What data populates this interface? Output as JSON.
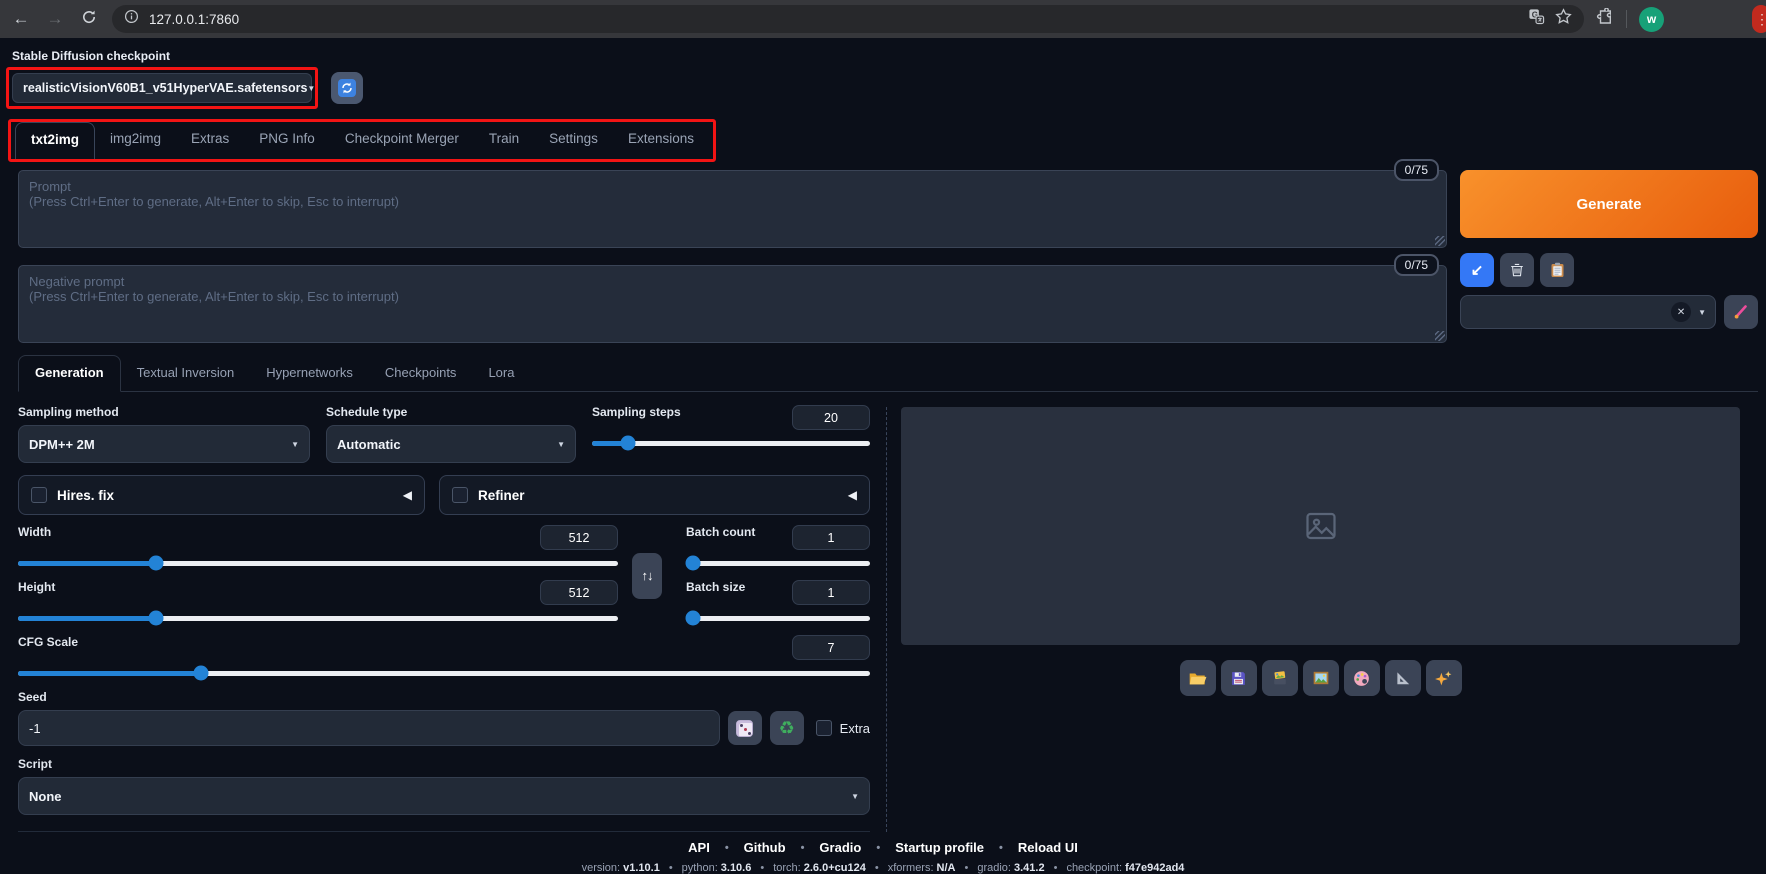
{
  "browser": {
    "url": "127.0.0.1:7860",
    "avatar_letter": "w"
  },
  "checkpoint": {
    "label": "Stable Diffusion checkpoint",
    "value": "realisticVisionV60B1_v51HyperVAE.safetensors"
  },
  "main_tabs": [
    "txt2img",
    "img2img",
    "Extras",
    "PNG Info",
    "Checkpoint Merger",
    "Train",
    "Settings",
    "Extensions"
  ],
  "active_main_tab": "txt2img",
  "prompt": {
    "counter": "0/75",
    "placeholder": "Prompt\n(Press Ctrl+Enter to generate, Alt+Enter to skip, Esc to interrupt)"
  },
  "negative_prompt": {
    "counter": "0/75",
    "placeholder": "Negative prompt\n(Press Ctrl+Enter to generate, Alt+Enter to skip, Esc to interrupt)"
  },
  "generate_label": "Generate",
  "sub_tabs": [
    "Generation",
    "Textual Inversion",
    "Hypernetworks",
    "Checkpoints",
    "Lora"
  ],
  "active_sub_tab": "Generation",
  "controls": {
    "sampling_method": {
      "label": "Sampling method",
      "value": "DPM++ 2M"
    },
    "schedule_type": {
      "label": "Schedule type",
      "value": "Automatic"
    },
    "sampling_steps": {
      "label": "Sampling steps",
      "value": "20",
      "fill_pct": 13
    },
    "hires_fix": {
      "label": "Hires. fix",
      "checked": false
    },
    "refiner": {
      "label": "Refiner",
      "checked": false
    },
    "width": {
      "label": "Width",
      "value": "512",
      "fill_pct": 23
    },
    "height": {
      "label": "Height",
      "value": "512",
      "fill_pct": 23
    },
    "batch_count": {
      "label": "Batch count",
      "value": "1",
      "fill_pct": 4
    },
    "batch_size": {
      "label": "Batch size",
      "value": "1",
      "fill_pct": 4
    },
    "cfg_scale": {
      "label": "CFG Scale",
      "value": "7",
      "fill_pct": 21.5
    },
    "seed": {
      "label": "Seed",
      "value": "-1",
      "extra_label": "Extra"
    },
    "script": {
      "label": "Script",
      "value": "None"
    }
  },
  "icons": {
    "toolbar": [
      "open-folder",
      "save-floppy",
      "save-zip",
      "picture-frame",
      "palette",
      "triangle-ruler",
      "sparkles"
    ],
    "prompt_tools": [
      "arrow-down-left",
      "trash",
      "clipboard"
    ]
  },
  "colors": {
    "accent_orange": "#ee7712",
    "accent_blue": "#2383d6",
    "annotation_red": "#f31414",
    "page_bg": "#0b0f19"
  },
  "footer": {
    "links": [
      "API",
      "Github",
      "Gradio",
      "Startup profile",
      "Reload UI"
    ],
    "info": [
      {
        "label": "version:",
        "value": "v1.10.1"
      },
      {
        "label": "python:",
        "value": "3.10.6"
      },
      {
        "label": "torch:",
        "value": "2.6.0+cu124"
      },
      {
        "label": "xformers:",
        "value": "N/A"
      },
      {
        "label": "gradio:",
        "value": "3.41.2"
      },
      {
        "label": "checkpoint:",
        "value": "f47e942ad4"
      }
    ]
  }
}
